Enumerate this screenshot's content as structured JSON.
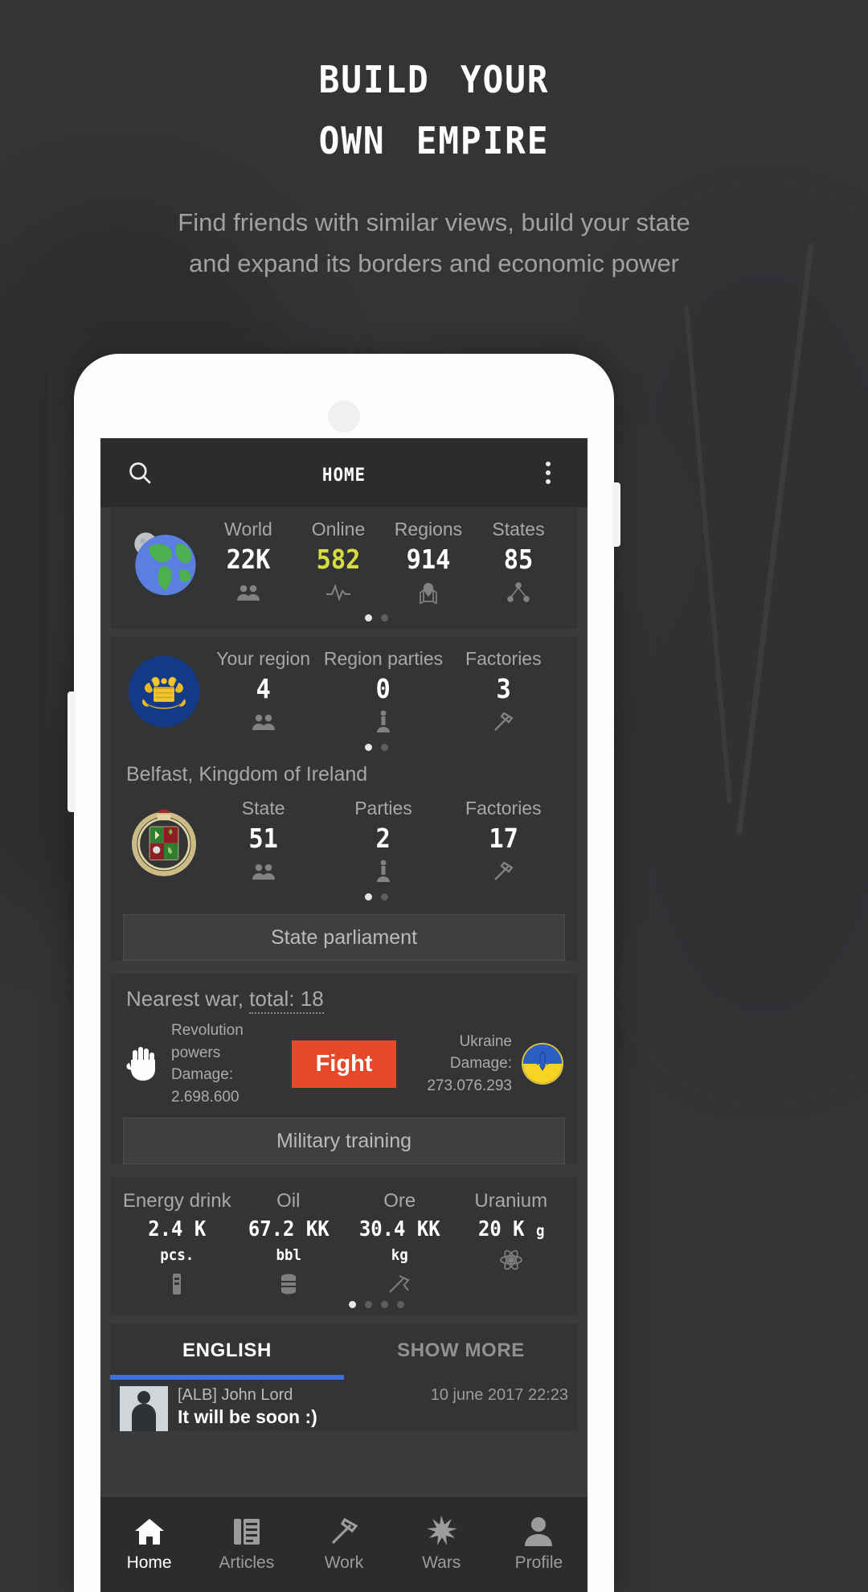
{
  "promo": {
    "headline_line1": "Build Your",
    "headline_line2": "Own Empire",
    "subtitle": "Find friends with similar views, build your state and expand its borders and economic power"
  },
  "app": {
    "toolbar": {
      "title": "Home",
      "search_icon": "search-icon",
      "overflow_icon": "more-vertical-icon"
    },
    "world_card": {
      "emblem": "earth-globe-icon",
      "cells": [
        {
          "label": "World",
          "value": "22K",
          "icon": "people-icon",
          "highlight": false
        },
        {
          "label": "Online",
          "value": "582",
          "icon": "pulse-icon",
          "highlight": true
        },
        {
          "label": "Regions",
          "value": "914",
          "icon": "map-pin-icon",
          "highlight": false
        },
        {
          "label": "States",
          "value": "85",
          "icon": "network-icon",
          "highlight": false
        }
      ],
      "pager": {
        "count": 2,
        "active": 0
      }
    },
    "region_card": {
      "emblem": "region-coat-of-arms-icon",
      "cells": [
        {
          "label": "Your region",
          "value": "4",
          "icon": "people-icon"
        },
        {
          "label": "Region parties",
          "value": "0",
          "icon": "podium-icon"
        },
        {
          "label": "Factories",
          "value": "3",
          "icon": "hammer-icon"
        }
      ],
      "pager": {
        "count": 2,
        "active": 0
      },
      "place": "Belfast, Kingdom of Ireland"
    },
    "state_card": {
      "emblem": "state-coat-of-arms-icon",
      "cells": [
        {
          "label": "State",
          "value": "51",
          "icon": "people-icon"
        },
        {
          "label": "Parties",
          "value": "2",
          "icon": "podium-icon"
        },
        {
          "label": "Factories",
          "value": "17",
          "icon": "hammer-icon"
        }
      ],
      "pager": {
        "count": 2,
        "active": 0
      },
      "button": "State parliament"
    },
    "war_card": {
      "title_prefix": "Nearest war, ",
      "title_link": "total: 18",
      "left": {
        "name": "Revolution powers",
        "damage": "Damage: 2.698.600",
        "icon": "raised-fist-icon"
      },
      "right": {
        "name": "Ukraine",
        "damage": "Damage: 273.076.293",
        "icon": "ukraine-flag-icon"
      },
      "fight_button": "Fight",
      "training_button": "Military training"
    },
    "resources": {
      "items": [
        {
          "label": "Energy drink",
          "value": "2.4 K",
          "unit": "pcs.",
          "icon": "energy-drink-icon"
        },
        {
          "label": "Oil",
          "value": "67.2 KK",
          "unit": "bbl",
          "icon": "oil-barrel-icon"
        },
        {
          "label": "Ore",
          "value": "30.4 KK",
          "unit": "kg",
          "icon": "ore-icon"
        },
        {
          "label": "Uranium",
          "value": "20 K",
          "unit": "g",
          "icon": "atom-icon"
        }
      ],
      "pager": {
        "count": 4,
        "active": 0
      }
    },
    "chat": {
      "tab_active": "ENGLISH",
      "tab_more": "SHOW MORE",
      "message": {
        "author": "[ALB] John Lord",
        "timestamp": "10 june 2017 22:23",
        "text": "It will be soon :)"
      }
    },
    "bottom_nav": [
      {
        "label": "Home",
        "icon": "home-icon",
        "active": true
      },
      {
        "label": "Articles",
        "icon": "articles-icon",
        "active": false
      },
      {
        "label": "Work",
        "icon": "hammer-icon",
        "active": false
      },
      {
        "label": "Wars",
        "icon": "star-burst-icon",
        "active": false
      },
      {
        "label": "Profile",
        "icon": "person-icon",
        "active": false
      }
    ]
  },
  "colors": {
    "page_bg": "#333436",
    "card_bg": "#333436",
    "screen_bg": "#3a3b3d",
    "toolbar_bg": "#2b2c2e",
    "accent_online": "#d7dd3f",
    "accent_fight": "#e5492a",
    "accent_tab": "#3f6fd8"
  }
}
